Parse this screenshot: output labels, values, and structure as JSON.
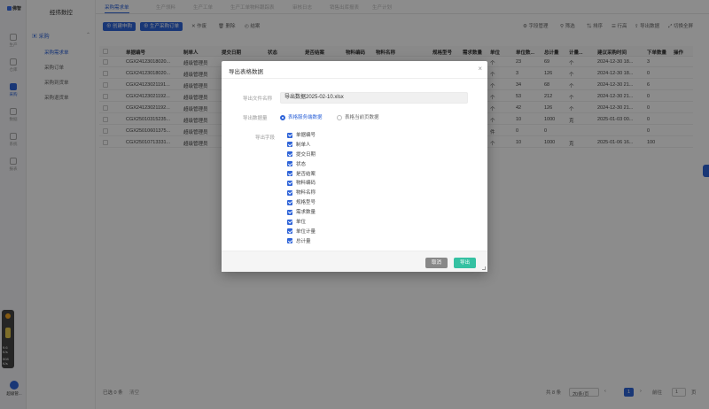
{
  "rail": {
    "logo": "佛智",
    "items": [
      "生产",
      "仓库",
      "采购",
      "数据",
      "系统",
      "报表"
    ]
  },
  "sidebar": {
    "title": "经纬数控",
    "group": "采购",
    "links": [
      "采购需求单",
      "采购订单",
      "采购到货单",
      "采购退货单"
    ]
  },
  "tabs": [
    "采购需求单",
    "生产领料",
    "生产工单",
    "生产工单物料跟踪表",
    "审核日志",
    "销售出库报表",
    "生产计划"
  ],
  "toolbar": {
    "create_order": "创建申购",
    "generate": "生产采购订单",
    "void": "作废",
    "delete": "删除",
    "close": "结案",
    "field_manage": "字段管理",
    "filter": "筛选",
    "sort": "排序",
    "row_height": "行高",
    "export": "导出数据",
    "fullscreen": "切换全屏"
  },
  "table": {
    "headers": [
      "单据编号",
      "制单人",
      "提交日期",
      "状态",
      "是否结案",
      "物料编码",
      "物料名称",
      "规格型号",
      "需求数量",
      "单位",
      "单位数...",
      "总计量",
      "计量...",
      "建议采购时间",
      "下单数量",
      "操作"
    ],
    "rows": [
      {
        "code": "CGX24123018020...",
        "maker": "超级管理员",
        "unit": "个",
        "qty": "23",
        "total": "69",
        "measure": "个",
        "date": "2024-12-30 18...",
        "order": "3"
      },
      {
        "code": "CGX24123018020...",
        "maker": "超级管理员",
        "unit": "个",
        "qty": "3",
        "total": "126",
        "measure": "个",
        "date": "2024-12-30 18...",
        "order": "0"
      },
      {
        "code": "CGX24123021191...",
        "maker": "超级管理员",
        "unit": "个",
        "qty": "34",
        "total": "68",
        "measure": "个",
        "date": "2024-12-30 21...",
        "order": "6"
      },
      {
        "code": "CGX24123021192...",
        "maker": "超级管理员",
        "unit": "个",
        "qty": "53",
        "total": "212",
        "measure": "个",
        "date": "2024-12-30 21...",
        "order": "0"
      },
      {
        "code": "CGX24123021192...",
        "maker": "超级管理员",
        "unit": "个",
        "qty": "42",
        "total": "126",
        "measure": "个",
        "date": "2024-12-30 21...",
        "order": "0"
      },
      {
        "code": "CGX25010315235...",
        "maker": "超级管理员",
        "unit": "个",
        "qty": "10",
        "total": "1000",
        "measure": "克",
        "date": "2025-01-03 00...",
        "order": "0"
      },
      {
        "code": "CGX25010601375...",
        "maker": "超级管理员",
        "unit": "件",
        "qty": "0",
        "total": "0",
        "measure": "",
        "date": "",
        "order": "0"
      },
      {
        "code": "CGX25010713331...",
        "maker": "超级管理员",
        "unit": "个",
        "qty": "10",
        "total": "1000",
        "measure": "克",
        "date": "2025-01-06 16...",
        "order": "100"
      }
    ]
  },
  "footer": {
    "selected": "已选 0 条",
    "action": "清空",
    "total": "共 8 条",
    "page_size": "20条/页",
    "current_page": "1",
    "goto_label": "前往",
    "goto_value": "1",
    "page_unit": "页"
  },
  "widget": {
    "v1": "9.6",
    "v2": "K/s",
    "v3": "508",
    "v4": "K/s"
  },
  "user": {
    "name": "超级管..."
  },
  "dialog": {
    "title": "导出表格数据",
    "filename_label": "导出文件名称",
    "filename": "导出数据2025-02-10.xlsx",
    "scope_label": "导出数据量",
    "scope_options": [
      "表格服务端数据",
      "表格当前页数据"
    ],
    "fields_label": "导出字段",
    "fields": [
      "单据编号",
      "制单人",
      "提交日期",
      "状态",
      "是否结案",
      "物料编码",
      "物料名称",
      "规格型号",
      "需求数量",
      "单位",
      "单位计量",
      "总计量"
    ],
    "cancel": "取消",
    "ok": "导出"
  }
}
